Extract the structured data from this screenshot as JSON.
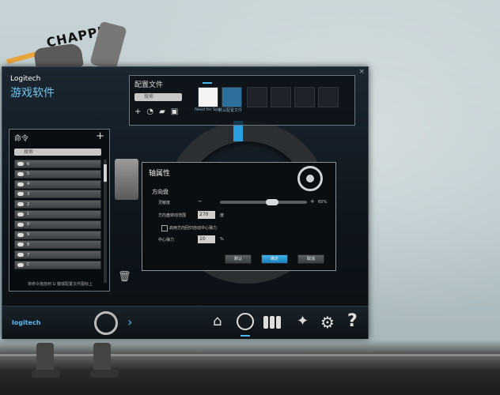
{
  "background": {
    "graffiti": "CHAPPIE"
  },
  "window": {
    "brand": "Logitech",
    "app_title": "游戏软件",
    "close_glyph": "×"
  },
  "profiles": {
    "title": "配置文件",
    "search_placeholder": "搜索",
    "slots": [
      {
        "label": "Need for Spe",
        "active": true
      },
      {
        "label": "默认配置文件",
        "active": false
      }
    ]
  },
  "commands": {
    "title": "命令",
    "add_glyph": "+",
    "search_placeholder": "搜索",
    "items": [
      "6",
      "5",
      "4",
      "3",
      "2",
      "1",
      "0",
      "9",
      "8",
      "7",
      "C"
    ],
    "hint": "将命令拖放到 G 键或配置文件图标上"
  },
  "dialog": {
    "title": "轴属性",
    "section": "方向盘",
    "sensitivity_label": "灵敏度",
    "sensitivity_percent": "65%",
    "sensitivity_value": 0.62,
    "rotation_label": "方向盘转动范围",
    "rotation_value": "270",
    "rotation_unit": "度",
    "centering_label": "启用方向回归自动中心弹力",
    "center_spring_label": "中心弹力",
    "center_spring_value": "10",
    "center_spring_unit": "%",
    "buttons": [
      "默认",
      "确定",
      "取消"
    ]
  },
  "bottom_bar": {
    "logo": "logitech"
  },
  "colors": {
    "accent": "#2aa0de",
    "brand_cn": "#6ec6f0"
  }
}
